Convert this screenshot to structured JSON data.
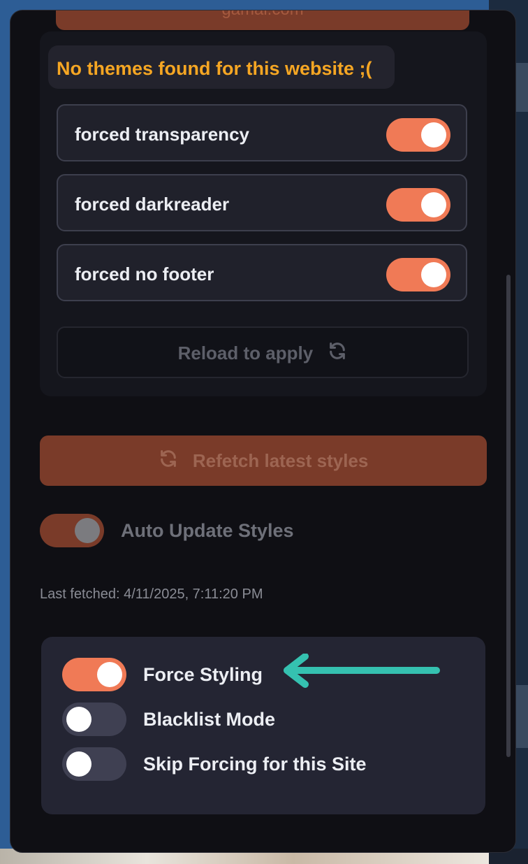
{
  "top_button": {
    "label": "gamal.com"
  },
  "themes": {
    "empty_message": "No themes found for this website ;(",
    "options": [
      {
        "label": "forced transparency",
        "enabled": true
      },
      {
        "label": "forced darkreader",
        "enabled": true
      },
      {
        "label": "forced no footer",
        "enabled": true
      }
    ],
    "reload_label": "Reload to apply",
    "reload_icon": "refresh-icon"
  },
  "refetch": {
    "label": "Refetch latest styles",
    "icon": "refresh-icon"
  },
  "auto_update": {
    "label": "Auto Update Styles",
    "enabled": true
  },
  "last_fetched": "Last fetched: 4/11/2025, 7:11:20 PM",
  "force_panel": {
    "items": [
      {
        "label": "Force Styling",
        "enabled": true
      },
      {
        "label": "Blacklist Mode",
        "enabled": false
      },
      {
        "label": "Skip Forcing for this Site",
        "enabled": false
      }
    ]
  },
  "colors": {
    "accent": "#f07a56",
    "accent_dim": "#7a3b29",
    "warning_text": "#f5a623",
    "annotation_arrow": "#35c1b0"
  }
}
